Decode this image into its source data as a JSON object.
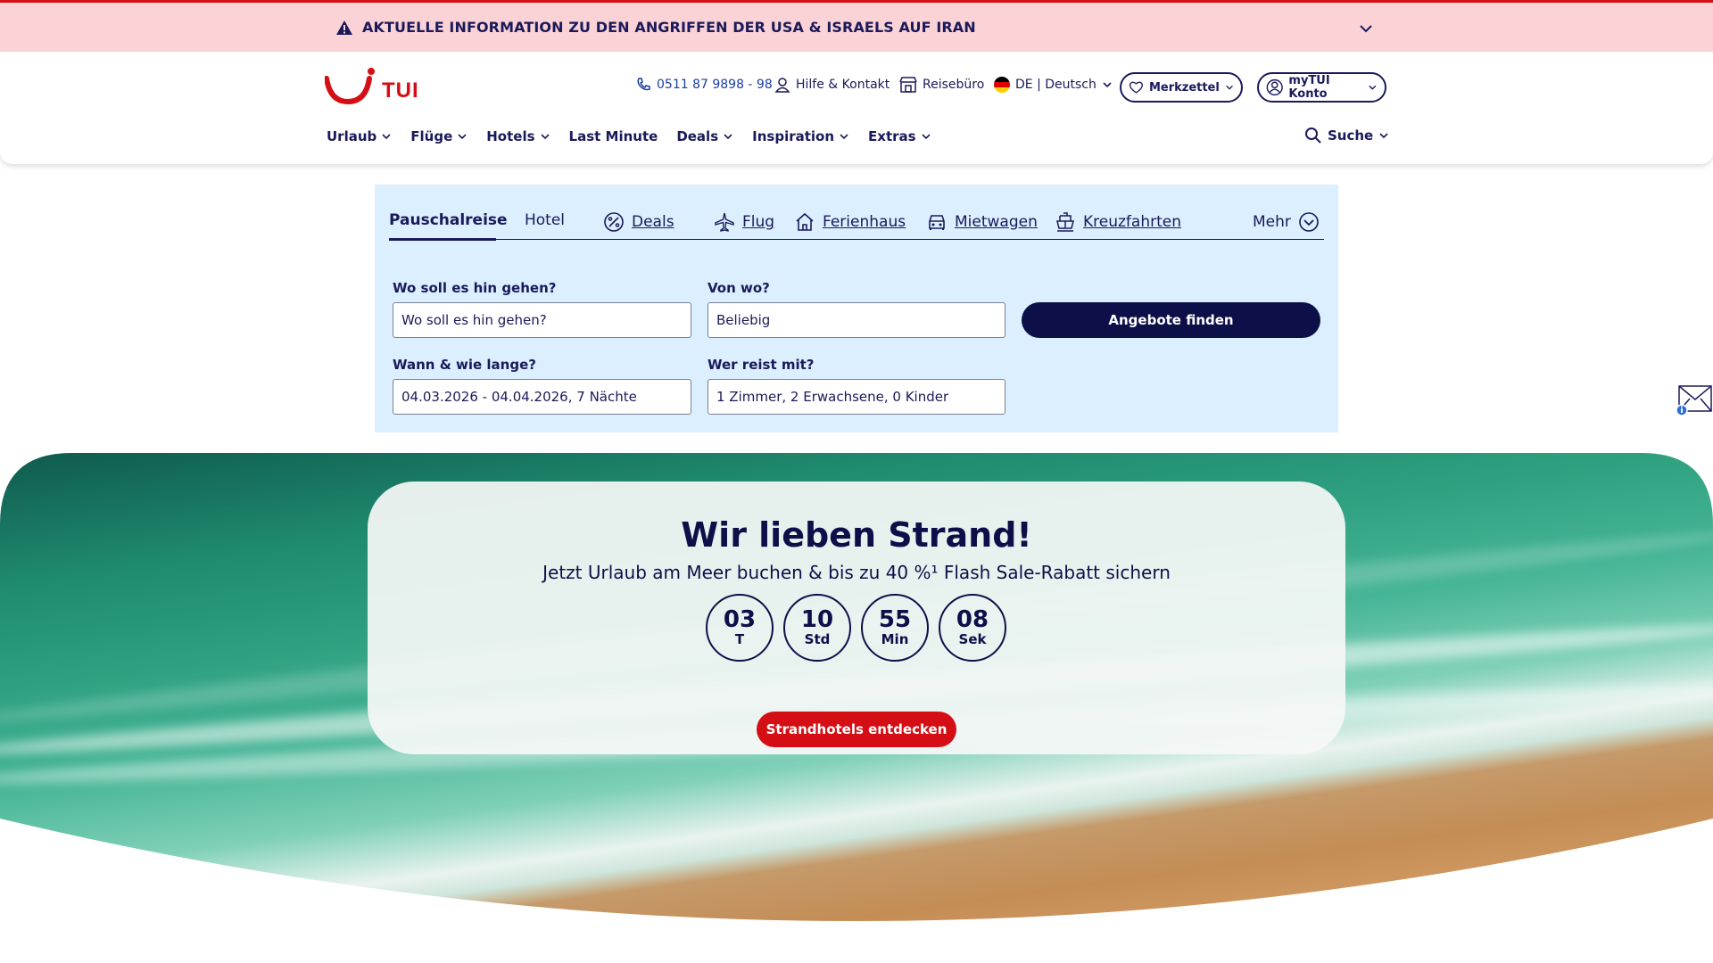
{
  "alert": {
    "text": "AKTUELLE INFORMATION ZU DEN ANGRIFFEN DER USA & ISRAELS AUF IRAN",
    "icon": "warning-icon",
    "color": "#fbd3d6"
  },
  "brand": {
    "name": "TUI",
    "color": "#d40e14"
  },
  "utility": {
    "phone": "0511 87 9898 - 98",
    "help": "Hilfe & Kontakt",
    "store": "Reisebüro",
    "lang": "DE | Deutsch",
    "wishlist": "Merkzettel",
    "account": "myTUI Konto"
  },
  "nav": {
    "items": [
      "Urlaub",
      "Flüge",
      "Hotels",
      "Last Minute",
      "Deals",
      "Inspiration",
      "Extras"
    ],
    "search": "Suche"
  },
  "search": {
    "tabs": [
      "Pauschalreise",
      "Hotel",
      "Deals",
      "Flug",
      "Ferienhaus",
      "Mietwagen",
      "Kreuzfahrten",
      "Mehr"
    ],
    "destination_label": "Wo soll es hin gehen?",
    "destination_placeholder": "Wo soll es hin gehen?",
    "origin_label": "Von wo?",
    "origin_value": "Beliebig",
    "dates_label": "Wann & wie lange?",
    "dates_value": "04.03.2026 - 04.04.2026, 7 Nächte",
    "travellers_label": "Wer reist mit?",
    "travellers_value": "1 Zimmer, 2 Erwachsene, 0 Kinder",
    "submit": "Angebote finden"
  },
  "hero": {
    "title": "Wir lieben Strand!",
    "subtitle": "Jetzt Urlaub am Meer buchen & bis zu 40 %¹ Flash Sale-Rabatt sichern",
    "countdown": [
      {
        "value": "03",
        "unit": "T"
      },
      {
        "value": "10",
        "unit": "Std"
      },
      {
        "value": "55",
        "unit": "Min"
      },
      {
        "value": "08",
        "unit": "Sek"
      }
    ],
    "button": "Strandhotels entdecken"
  }
}
